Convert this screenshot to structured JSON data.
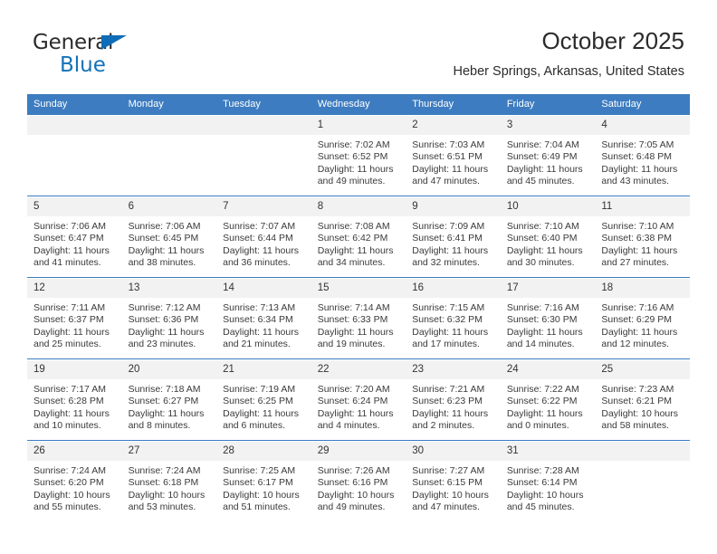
{
  "brand": {
    "name_part1": "General",
    "name_part2": "Blue",
    "triangle_color": "#0f6cb6",
    "blue_text_color": "#1272b8"
  },
  "header": {
    "title": "October 2025",
    "subtitle": "Heber Springs, Arkansas, United States"
  },
  "theme": {
    "header_row_bg": "#3d7cc0",
    "header_row_text": "#ffffff",
    "daynum_bg": "#f2f2f2",
    "separator": "#3d7cc0"
  },
  "columns": [
    "Sunday",
    "Monday",
    "Tuesday",
    "Wednesday",
    "Thursday",
    "Friday",
    "Saturday"
  ],
  "labels": {
    "sunrise": "Sunrise:",
    "sunset": "Sunset:",
    "daylight": "Daylight:"
  },
  "weeks": [
    [
      {
        "day": "",
        "blank": true
      },
      {
        "day": "",
        "blank": true
      },
      {
        "day": "",
        "blank": true
      },
      {
        "day": "1",
        "sunrise": "Sunrise: 7:02 AM",
        "sunset": "Sunset: 6:52 PM",
        "daylight_line1": "Daylight: 11 hours",
        "daylight_line2": "and 49 minutes."
      },
      {
        "day": "2",
        "sunrise": "Sunrise: 7:03 AM",
        "sunset": "Sunset: 6:51 PM",
        "daylight_line1": "Daylight: 11 hours",
        "daylight_line2": "and 47 minutes."
      },
      {
        "day": "3",
        "sunrise": "Sunrise: 7:04 AM",
        "sunset": "Sunset: 6:49 PM",
        "daylight_line1": "Daylight: 11 hours",
        "daylight_line2": "and 45 minutes."
      },
      {
        "day": "4",
        "sunrise": "Sunrise: 7:05 AM",
        "sunset": "Sunset: 6:48 PM",
        "daylight_line1": "Daylight: 11 hours",
        "daylight_line2": "and 43 minutes."
      }
    ],
    [
      {
        "day": "5",
        "sunrise": "Sunrise: 7:06 AM",
        "sunset": "Sunset: 6:47 PM",
        "daylight_line1": "Daylight: 11 hours",
        "daylight_line2": "and 41 minutes."
      },
      {
        "day": "6",
        "sunrise": "Sunrise: 7:06 AM",
        "sunset": "Sunset: 6:45 PM",
        "daylight_line1": "Daylight: 11 hours",
        "daylight_line2": "and 38 minutes."
      },
      {
        "day": "7",
        "sunrise": "Sunrise: 7:07 AM",
        "sunset": "Sunset: 6:44 PM",
        "daylight_line1": "Daylight: 11 hours",
        "daylight_line2": "and 36 minutes."
      },
      {
        "day": "8",
        "sunrise": "Sunrise: 7:08 AM",
        "sunset": "Sunset: 6:42 PM",
        "daylight_line1": "Daylight: 11 hours",
        "daylight_line2": "and 34 minutes."
      },
      {
        "day": "9",
        "sunrise": "Sunrise: 7:09 AM",
        "sunset": "Sunset: 6:41 PM",
        "daylight_line1": "Daylight: 11 hours",
        "daylight_line2": "and 32 minutes."
      },
      {
        "day": "10",
        "sunrise": "Sunrise: 7:10 AM",
        "sunset": "Sunset: 6:40 PM",
        "daylight_line1": "Daylight: 11 hours",
        "daylight_line2": "and 30 minutes."
      },
      {
        "day": "11",
        "sunrise": "Sunrise: 7:10 AM",
        "sunset": "Sunset: 6:38 PM",
        "daylight_line1": "Daylight: 11 hours",
        "daylight_line2": "and 27 minutes."
      }
    ],
    [
      {
        "day": "12",
        "sunrise": "Sunrise: 7:11 AM",
        "sunset": "Sunset: 6:37 PM",
        "daylight_line1": "Daylight: 11 hours",
        "daylight_line2": "and 25 minutes."
      },
      {
        "day": "13",
        "sunrise": "Sunrise: 7:12 AM",
        "sunset": "Sunset: 6:36 PM",
        "daylight_line1": "Daylight: 11 hours",
        "daylight_line2": "and 23 minutes."
      },
      {
        "day": "14",
        "sunrise": "Sunrise: 7:13 AM",
        "sunset": "Sunset: 6:34 PM",
        "daylight_line1": "Daylight: 11 hours",
        "daylight_line2": "and 21 minutes."
      },
      {
        "day": "15",
        "sunrise": "Sunrise: 7:14 AM",
        "sunset": "Sunset: 6:33 PM",
        "daylight_line1": "Daylight: 11 hours",
        "daylight_line2": "and 19 minutes."
      },
      {
        "day": "16",
        "sunrise": "Sunrise: 7:15 AM",
        "sunset": "Sunset: 6:32 PM",
        "daylight_line1": "Daylight: 11 hours",
        "daylight_line2": "and 17 minutes."
      },
      {
        "day": "17",
        "sunrise": "Sunrise: 7:16 AM",
        "sunset": "Sunset: 6:30 PM",
        "daylight_line1": "Daylight: 11 hours",
        "daylight_line2": "and 14 minutes."
      },
      {
        "day": "18",
        "sunrise": "Sunrise: 7:16 AM",
        "sunset": "Sunset: 6:29 PM",
        "daylight_line1": "Daylight: 11 hours",
        "daylight_line2": "and 12 minutes."
      }
    ],
    [
      {
        "day": "19",
        "sunrise": "Sunrise: 7:17 AM",
        "sunset": "Sunset: 6:28 PM",
        "daylight_line1": "Daylight: 11 hours",
        "daylight_line2": "and 10 minutes."
      },
      {
        "day": "20",
        "sunrise": "Sunrise: 7:18 AM",
        "sunset": "Sunset: 6:27 PM",
        "daylight_line1": "Daylight: 11 hours",
        "daylight_line2": "and 8 minutes."
      },
      {
        "day": "21",
        "sunrise": "Sunrise: 7:19 AM",
        "sunset": "Sunset: 6:25 PM",
        "daylight_line1": "Daylight: 11 hours",
        "daylight_line2": "and 6 minutes."
      },
      {
        "day": "22",
        "sunrise": "Sunrise: 7:20 AM",
        "sunset": "Sunset: 6:24 PM",
        "daylight_line1": "Daylight: 11 hours",
        "daylight_line2": "and 4 minutes."
      },
      {
        "day": "23",
        "sunrise": "Sunrise: 7:21 AM",
        "sunset": "Sunset: 6:23 PM",
        "daylight_line1": "Daylight: 11 hours",
        "daylight_line2": "and 2 minutes."
      },
      {
        "day": "24",
        "sunrise": "Sunrise: 7:22 AM",
        "sunset": "Sunset: 6:22 PM",
        "daylight_line1": "Daylight: 11 hours",
        "daylight_line2": "and 0 minutes."
      },
      {
        "day": "25",
        "sunrise": "Sunrise: 7:23 AM",
        "sunset": "Sunset: 6:21 PM",
        "daylight_line1": "Daylight: 10 hours",
        "daylight_line2": "and 58 minutes."
      }
    ],
    [
      {
        "day": "26",
        "sunrise": "Sunrise: 7:24 AM",
        "sunset": "Sunset: 6:20 PM",
        "daylight_line1": "Daylight: 10 hours",
        "daylight_line2": "and 55 minutes."
      },
      {
        "day": "27",
        "sunrise": "Sunrise: 7:24 AM",
        "sunset": "Sunset: 6:18 PM",
        "daylight_line1": "Daylight: 10 hours",
        "daylight_line2": "and 53 minutes."
      },
      {
        "day": "28",
        "sunrise": "Sunrise: 7:25 AM",
        "sunset": "Sunset: 6:17 PM",
        "daylight_line1": "Daylight: 10 hours",
        "daylight_line2": "and 51 minutes."
      },
      {
        "day": "29",
        "sunrise": "Sunrise: 7:26 AM",
        "sunset": "Sunset: 6:16 PM",
        "daylight_line1": "Daylight: 10 hours",
        "daylight_line2": "and 49 minutes."
      },
      {
        "day": "30",
        "sunrise": "Sunrise: 7:27 AM",
        "sunset": "Sunset: 6:15 PM",
        "daylight_line1": "Daylight: 10 hours",
        "daylight_line2": "and 47 minutes."
      },
      {
        "day": "31",
        "sunrise": "Sunrise: 7:28 AM",
        "sunset": "Sunset: 6:14 PM",
        "daylight_line1": "Daylight: 10 hours",
        "daylight_line2": "and 45 minutes."
      },
      {
        "day": "",
        "blank": true
      }
    ]
  ]
}
